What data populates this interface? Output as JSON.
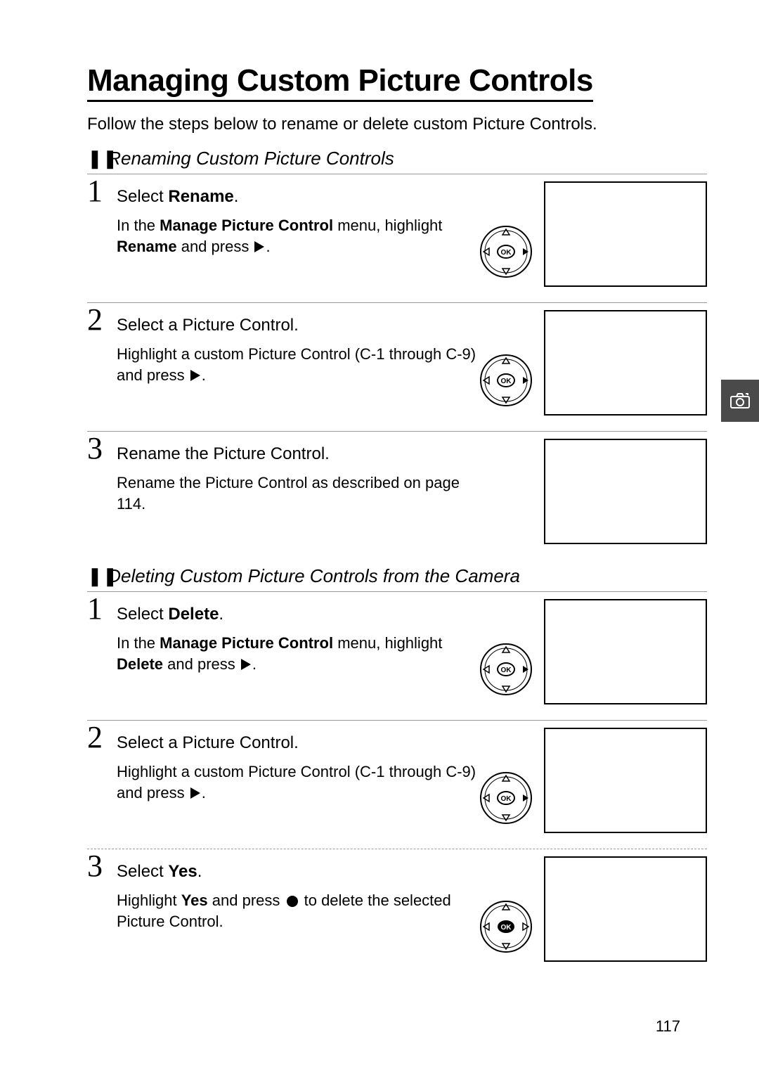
{
  "title": "Managing Custom Picture Controls",
  "intro": "Follow the steps below to rename or delete custom Picture Controls.",
  "section_rename": {
    "marker": "❚❚",
    "title": "Renaming Custom Picture Controls",
    "steps": [
      {
        "num": "1",
        "head_a": "Select ",
        "head_b": "Rename",
        "head_c": ".",
        "body_a": "In the ",
        "body_b": "Manage Picture Control",
        "body_c": " menu, highlight ",
        "body_d": "Rename",
        "body_e": " and press "
      },
      {
        "num": "2",
        "head": "Select a Picture Control.",
        "body_a": "Highlight a custom Picture Control (C-1 through C-9) and press "
      },
      {
        "num": "3",
        "head": "Rename the Picture Control.",
        "body": "Rename the Picture Control as described on page 114."
      }
    ]
  },
  "section_delete": {
    "marker": "❚❚",
    "title": "Deleting Custom Picture Controls from the Camera",
    "steps": [
      {
        "num": "1",
        "head_a": "Select ",
        "head_b": "Delete",
        "head_c": ".",
        "body_a": "In the ",
        "body_b": "Manage Picture Control",
        "body_c": " menu, highlight ",
        "body_d": "Delete",
        "body_e": " and press "
      },
      {
        "num": "2",
        "head": "Select a Picture Control.",
        "body_a": "Highlight a custom Picture Control (C-1 through C-9) and press "
      },
      {
        "num": "3",
        "head_a": "Select ",
        "head_b": "Yes",
        "head_c": ".",
        "body_a": "Highlight ",
        "body_b": "Yes",
        "body_c": " and press ",
        "body_d": " to delete the selected Picture Control."
      }
    ]
  },
  "page_number": "117"
}
